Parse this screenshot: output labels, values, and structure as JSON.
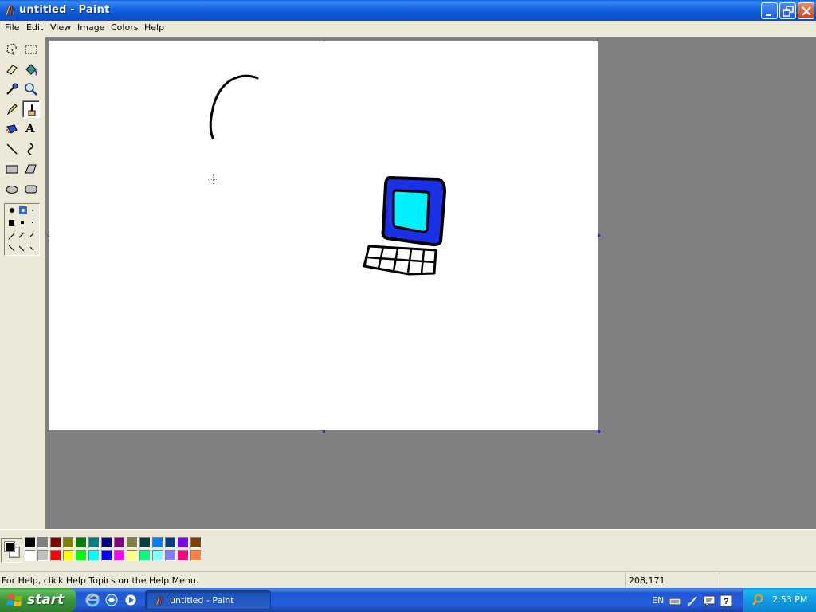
{
  "window": {
    "title": "untitled - Paint"
  },
  "menu": [
    "File",
    "Edit",
    "View",
    "Image",
    "Colors",
    "Help"
  ],
  "tools": [
    {
      "name": "free-form-select-icon"
    },
    {
      "name": "rect-select-icon"
    },
    {
      "name": "eraser-icon"
    },
    {
      "name": "fill-icon"
    },
    {
      "name": "pick-color-icon"
    },
    {
      "name": "magnifier-icon"
    },
    {
      "name": "pencil-icon"
    },
    {
      "name": "brush-icon"
    },
    {
      "name": "airbrush-icon"
    },
    {
      "name": "text-icon"
    },
    {
      "name": "line-icon"
    },
    {
      "name": "curve-icon"
    },
    {
      "name": "rectangle-icon"
    },
    {
      "name": "polygon-icon"
    },
    {
      "name": "ellipse-icon"
    },
    {
      "name": "rounded-rect-icon"
    }
  ],
  "active_tool": "brush-icon",
  "text_tool_label": "A",
  "palette_top": [
    "#000000",
    "#808080",
    "#800000",
    "#808000",
    "#008000",
    "#008080",
    "#000080",
    "#800080",
    "#808040",
    "#004040",
    "#0080ff",
    "#004080",
    "#8000ff",
    "#804000"
  ],
  "palette_bottom": [
    "#ffffff",
    "#c0c0c0",
    "#ff0000",
    "#ffff00",
    "#00ff00",
    "#00ffff",
    "#0000ff",
    "#ff00ff",
    "#ffff80",
    "#00ff80",
    "#80ffff",
    "#8080ff",
    "#ff0080",
    "#ff8040"
  ],
  "current_colors": {
    "foreground": "#000000",
    "background": "#ffffff"
  },
  "status": {
    "help": "For Help, click Help Topics on the Help Menu.",
    "coords": "208,171"
  },
  "taskbar": {
    "start_label": "start",
    "task_label": "untitled - Paint",
    "language": "EN",
    "time": "2:53 PM"
  },
  "drawing": {
    "laptop_frame_color": "#1a2fe6",
    "laptop_screen_color": "#00f0ff",
    "outline_color": "#000000"
  }
}
